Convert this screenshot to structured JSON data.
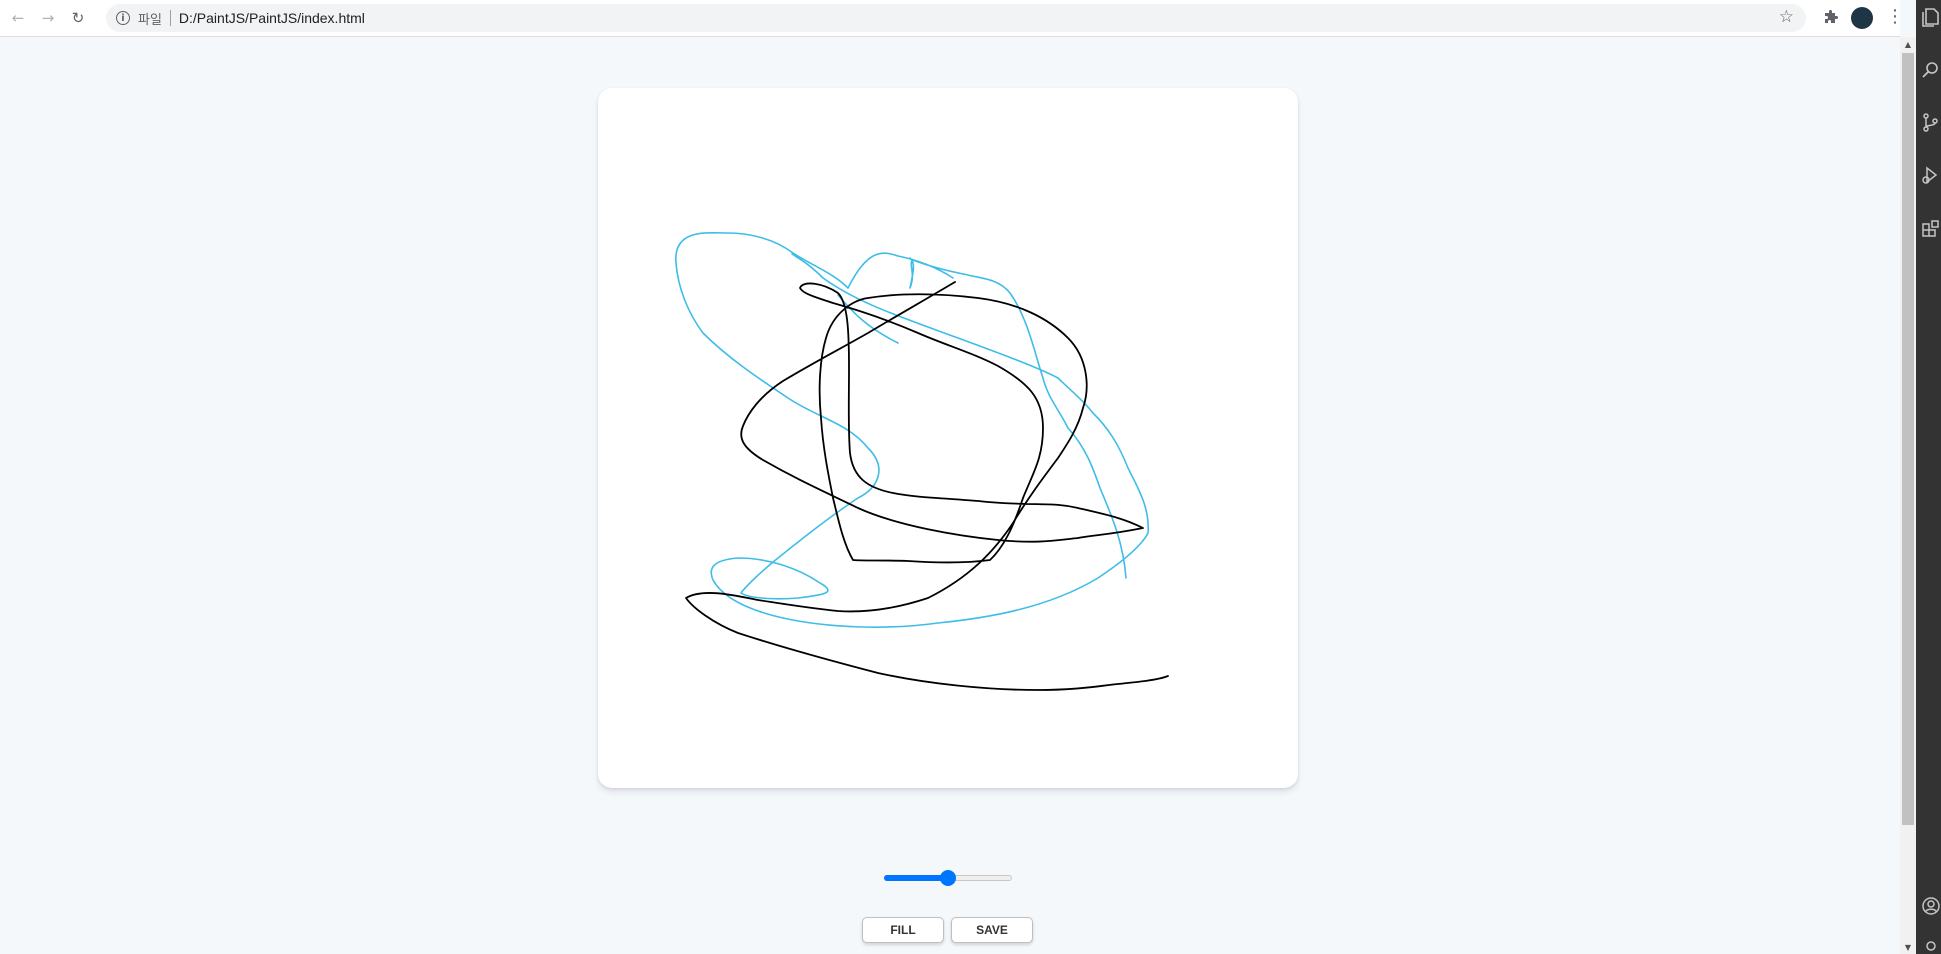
{
  "browser": {
    "toolbar": {
      "back_icon": "arrow-left-icon",
      "forward_icon": "arrow-right-icon",
      "reload_icon": "reload-icon",
      "omnibox": {
        "scheme_label": "파일",
        "url": "D:/PaintJS/PaintJS/index.html"
      },
      "bookmark_icon": "star-icon",
      "extensions_icon": "puzzle-icon",
      "menu_icon": "more-vertical-icon"
    }
  },
  "page": {
    "canvas": {
      "background": "#ffffff",
      "strokes": [
        {
          "color": "#3ebde8",
          "label": "blue-stroke"
        },
        {
          "color": "#000000",
          "label": "black-stroke"
        }
      ]
    },
    "controls": {
      "brush_range": {
        "value": 0.5,
        "fill_color": "#0075ff"
      },
      "fill_label": "Fill",
      "save_label": "Save"
    }
  },
  "side_panel": {
    "icons": [
      "files-icon",
      "search-icon",
      "source-control-icon",
      "debug-icon",
      "extensions-icon",
      "account-icon"
    ]
  }
}
